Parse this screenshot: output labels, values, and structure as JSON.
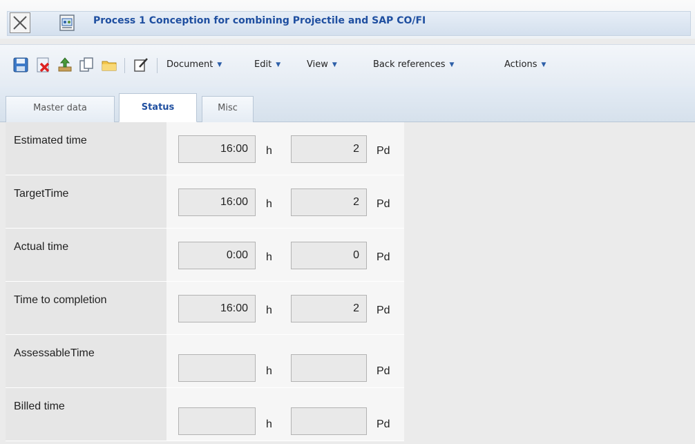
{
  "window": {
    "title": "Process 1 Conception for combining Projectile and SAP CO/FI",
    "close_icon": "close-x-icon",
    "doc_icon": "process-document-icon"
  },
  "toolbar": {
    "icons": [
      "save-icon",
      "delete-icon",
      "upload-icon",
      "copy-icon",
      "folder-icon",
      "edit-note-icon"
    ],
    "menus": [
      {
        "label": "Document"
      },
      {
        "label": "Edit"
      },
      {
        "label": "View"
      },
      {
        "label": "Back references"
      },
      {
        "label": "Actions"
      }
    ],
    "accent": "#2d5fa8"
  },
  "tabs": [
    {
      "label": "Master data",
      "active": false
    },
    {
      "label": "Status",
      "active": true
    },
    {
      "label": "Misc",
      "active": false
    }
  ],
  "status": {
    "hour_unit": "h",
    "day_unit": "Pd",
    "rows": [
      {
        "label": "Estimated time",
        "hours": "16:00",
        "days": "2"
      },
      {
        "label": "TargetTime",
        "hours": "16:00",
        "days": "2"
      },
      {
        "label": "Actual time",
        "hours": "0:00",
        "days": "0"
      },
      {
        "label": "Time to completion",
        "hours": "16:00",
        "days": "2"
      },
      {
        "label": "AssessableTime",
        "hours": "",
        "days": ""
      },
      {
        "label": "Billed time",
        "hours": "",
        "days": ""
      }
    ]
  }
}
